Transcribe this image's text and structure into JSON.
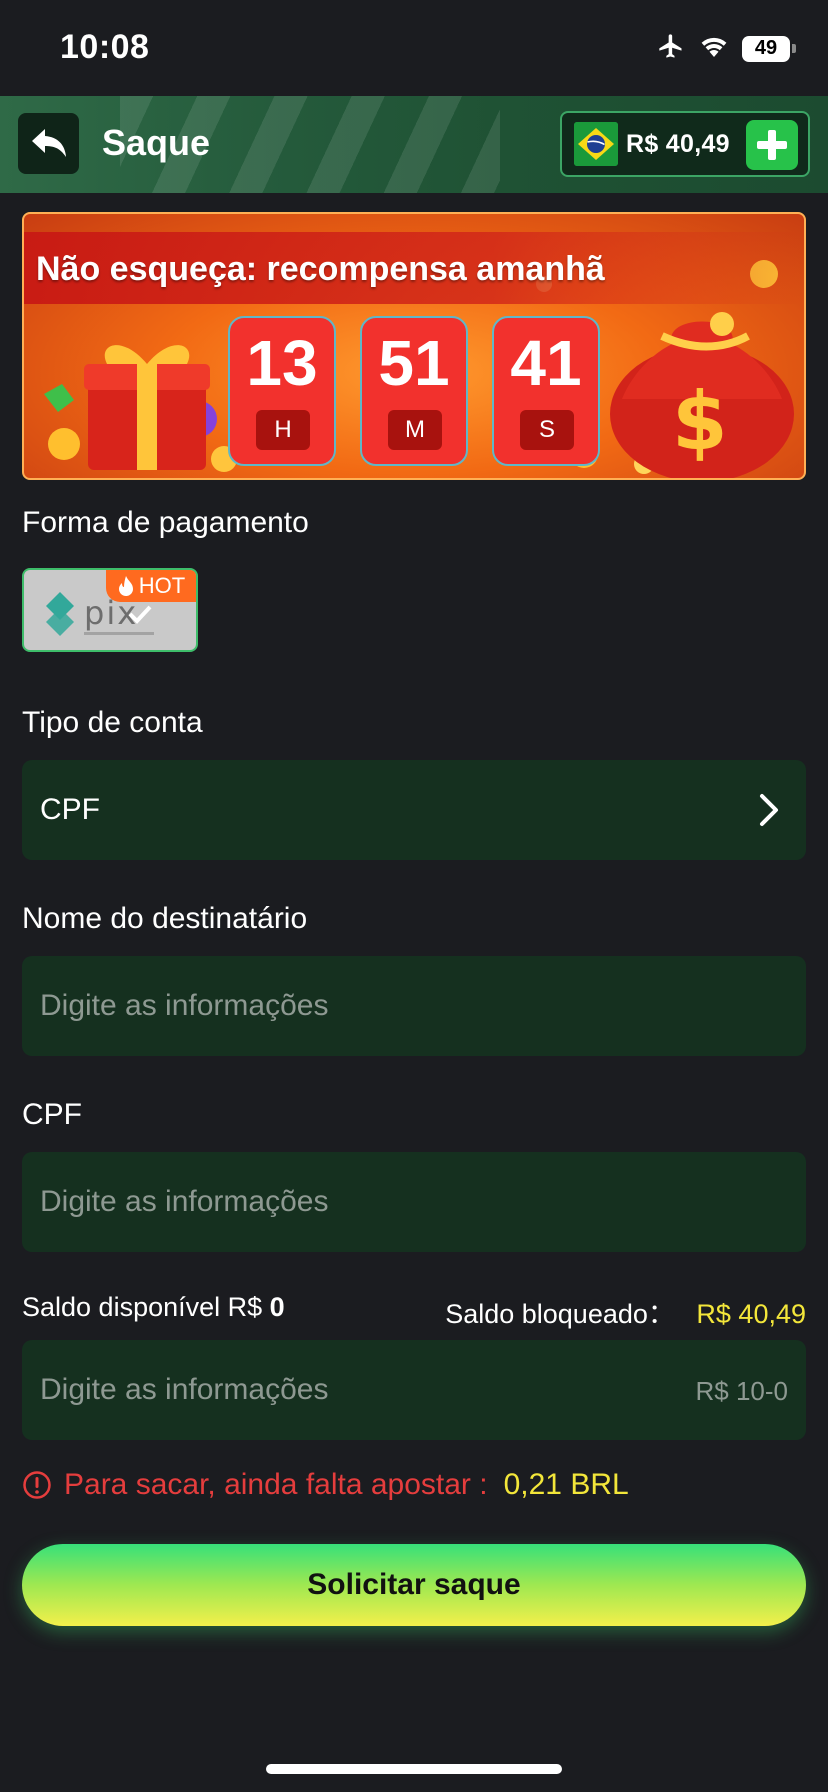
{
  "status_bar": {
    "time": "10:08",
    "battery": "49"
  },
  "header": {
    "title": "Saque",
    "balance": "R$ 40,49"
  },
  "banner": {
    "title": "Não esqueça: recompensa amanhã",
    "timer": [
      {
        "value": "13",
        "unit": "H"
      },
      {
        "value": "51",
        "unit": "M"
      },
      {
        "value": "41",
        "unit": "S"
      }
    ]
  },
  "payment": {
    "label": "Forma de pagamento",
    "method_logo": "pix",
    "badge": "HOT"
  },
  "account_type": {
    "label": "Tipo de conta",
    "value": "CPF"
  },
  "recipient": {
    "label": "Nome do destinatário",
    "placeholder": "Digite as informações"
  },
  "cpf": {
    "label": "CPF",
    "placeholder": "Digite as informações"
  },
  "balances": {
    "available_label": "Saldo disponível R$",
    "available_value": "0",
    "blocked_label": "Saldo bloqueado：",
    "blocked_value": "R$ 40,49"
  },
  "amount": {
    "placeholder": "Digite as informações",
    "range_hint": "R$ 10-0"
  },
  "warning": {
    "text": "Para sacar, ainda falta apostar :",
    "value": "0,21 BRL"
  },
  "submit": {
    "label": "Solicitar saque"
  },
  "colors": {
    "accent_green": "#27c24a",
    "field_bg": "#15301f",
    "highlight_yellow": "#f3e63a",
    "warning_red": "#e53d3d"
  }
}
